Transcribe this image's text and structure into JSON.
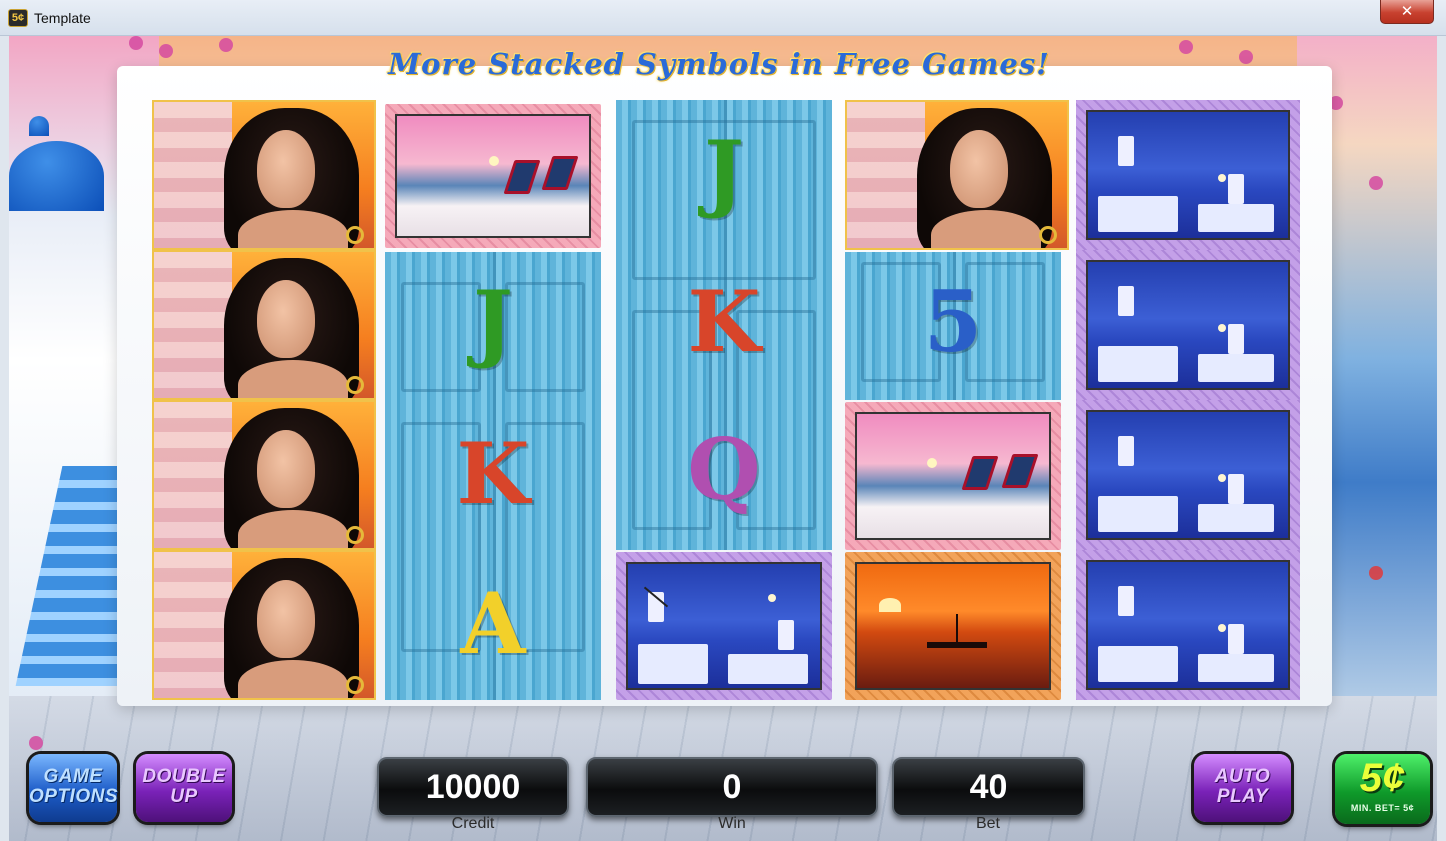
{
  "window": {
    "title": "Template",
    "close_glyph": "✕",
    "app_icon_text": "5¢"
  },
  "banner": "More Stacked Symbols in Free Games!",
  "reels": {
    "reel1": [
      "woman",
      "woman",
      "woman",
      "woman"
    ],
    "reel2": [
      "deckchairs",
      "J",
      "K",
      "A"
    ],
    "reel3": [
      "J",
      "K",
      "Q",
      "windmill"
    ],
    "reel4": [
      "woman",
      "5",
      "deckchairs",
      "sunset-ship"
    ],
    "reel5": [
      "windmill",
      "windmill",
      "windmill",
      "windmill"
    ]
  },
  "letters": {
    "reel2_j": "J",
    "reel2_k": "K",
    "reel2_a": "A",
    "reel3_j": "J",
    "reel3_k": "K",
    "reel3_q": "Q",
    "reel4_5": "5"
  },
  "letter_colors": {
    "J": "#2f9a24",
    "K": "#d8452a",
    "Q": "#b04fb0",
    "A": "#f2d02a",
    "5": "#2a5fc8"
  },
  "controls": {
    "game_options_line1": "GAME",
    "game_options_line2": "OPTIONS",
    "double_up_line1": "DOUBLE",
    "double_up_line2": "UP",
    "auto_play_line1": "AUTO",
    "auto_play_line2": "PLAY",
    "denomination": "5¢",
    "min_bet": "MIN. BET= 5¢"
  },
  "meters": {
    "credit_value": "10000",
    "credit_label": "Credit",
    "win_value": "0",
    "win_label": "Win",
    "bet_value": "40",
    "bet_label": "Bet"
  }
}
